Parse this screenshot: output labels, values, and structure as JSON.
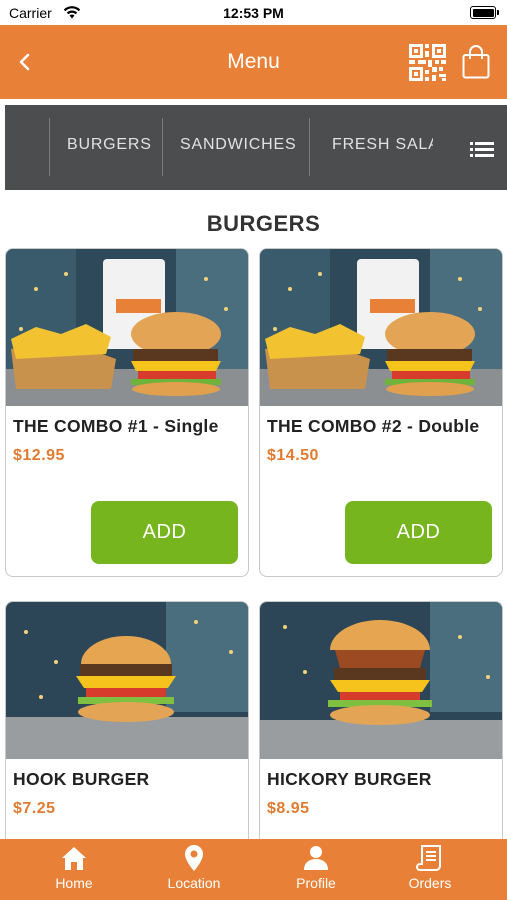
{
  "status_bar": {
    "carrier": "Carrier",
    "time": "12:53 PM"
  },
  "nav": {
    "title": "Menu",
    "back_icon": "chevron-left-icon",
    "qr_icon": "qr-code-icon",
    "bag_icon": "shopping-bag-icon"
  },
  "categories": {
    "items": [
      {
        "label": "BURGERS"
      },
      {
        "label": "SANDWICHES"
      },
      {
        "label": "FRESH SALA"
      }
    ],
    "menu_icon": "list-icon"
  },
  "section": {
    "title": "BURGERS"
  },
  "products": [
    {
      "name": "THE COMBO #1 - Single",
      "price": "$12.95",
      "add_label": "ADD",
      "image": "combo-burger-fries-drink"
    },
    {
      "name": "THE COMBO #2 - Double",
      "price": "$14.50",
      "add_label": "ADD",
      "image": "combo-burger-fries-drink"
    },
    {
      "name": "HOOK BURGER",
      "price": "$7.25",
      "image": "cheeseburger"
    },
    {
      "name": "HICKORY BURGER",
      "price": "$8.95",
      "image": "hickory-onion-burger"
    }
  ],
  "tabs": [
    {
      "label": "Home",
      "icon": "home-icon"
    },
    {
      "label": "Location",
      "icon": "location-pin-icon"
    },
    {
      "label": "Profile",
      "icon": "person-icon"
    },
    {
      "label": "Orders",
      "icon": "receipt-icon"
    }
  ],
  "colors": {
    "brand_orange": "#e88137",
    "add_green": "#77b51f",
    "price_orange": "#e07b30",
    "category_bar": "#4b4d4f"
  }
}
